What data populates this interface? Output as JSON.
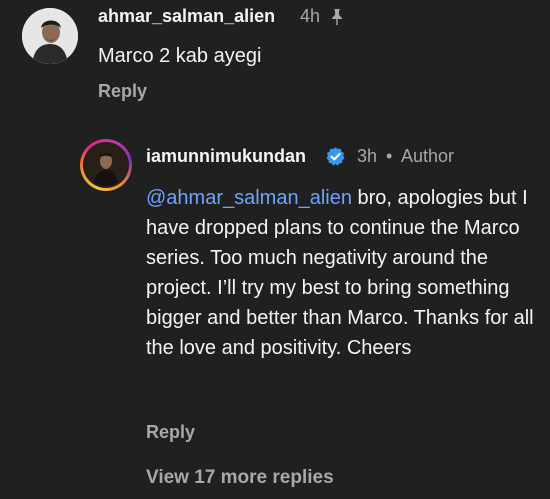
{
  "comment": {
    "username": "ahmar_salman_alien",
    "time": "4h",
    "pin_icon": "pin-icon",
    "text": "Marco 2 kab ayegi",
    "reply_label": "Reply"
  },
  "reply": {
    "username": "iamunnimukundan",
    "verified_icon": "verified-badge-icon",
    "time": "3h",
    "separator": "•",
    "author_label": "Author",
    "mention": "@ahmar_salman_alien",
    "text_after_mention": " bro, apologies but I have dropped plans to continue the Marco series. Too much negativity around the project. I’ll try my best to bring something bigger and better than Marco. Thanks for all the love and positivity. Cheers",
    "reply_label": "Reply"
  },
  "view_more_label": "View 17 more replies",
  "colors": {
    "background": "#202020",
    "mention": "#6ea3ff",
    "verified": "#3897f0",
    "muted": "#a8a8a8"
  }
}
